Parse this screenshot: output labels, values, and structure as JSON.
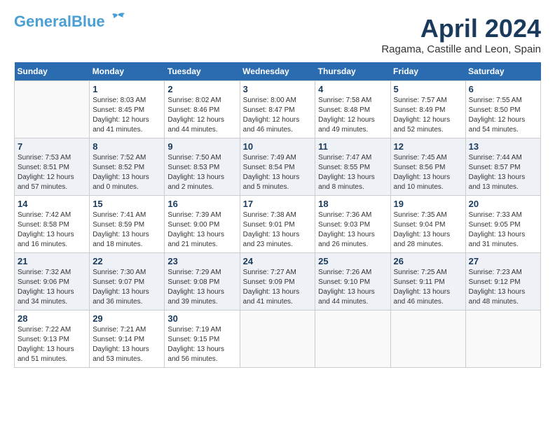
{
  "header": {
    "logo_line1": "General",
    "logo_line2": "Blue",
    "month_title": "April 2024",
    "location": "Ragama, Castille and Leon, Spain"
  },
  "days_of_week": [
    "Sunday",
    "Monday",
    "Tuesday",
    "Wednesday",
    "Thursday",
    "Friday",
    "Saturday"
  ],
  "weeks": [
    [
      {
        "day": "",
        "info": ""
      },
      {
        "day": "1",
        "info": "Sunrise: 8:03 AM\nSunset: 8:45 PM\nDaylight: 12 hours\nand 41 minutes."
      },
      {
        "day": "2",
        "info": "Sunrise: 8:02 AM\nSunset: 8:46 PM\nDaylight: 12 hours\nand 44 minutes."
      },
      {
        "day": "3",
        "info": "Sunrise: 8:00 AM\nSunset: 8:47 PM\nDaylight: 12 hours\nand 46 minutes."
      },
      {
        "day": "4",
        "info": "Sunrise: 7:58 AM\nSunset: 8:48 PM\nDaylight: 12 hours\nand 49 minutes."
      },
      {
        "day": "5",
        "info": "Sunrise: 7:57 AM\nSunset: 8:49 PM\nDaylight: 12 hours\nand 52 minutes."
      },
      {
        "day": "6",
        "info": "Sunrise: 7:55 AM\nSunset: 8:50 PM\nDaylight: 12 hours\nand 54 minutes."
      }
    ],
    [
      {
        "day": "7",
        "info": "Sunrise: 7:53 AM\nSunset: 8:51 PM\nDaylight: 12 hours\nand 57 minutes."
      },
      {
        "day": "8",
        "info": "Sunrise: 7:52 AM\nSunset: 8:52 PM\nDaylight: 13 hours\nand 0 minutes."
      },
      {
        "day": "9",
        "info": "Sunrise: 7:50 AM\nSunset: 8:53 PM\nDaylight: 13 hours\nand 2 minutes."
      },
      {
        "day": "10",
        "info": "Sunrise: 7:49 AM\nSunset: 8:54 PM\nDaylight: 13 hours\nand 5 minutes."
      },
      {
        "day": "11",
        "info": "Sunrise: 7:47 AM\nSunset: 8:55 PM\nDaylight: 13 hours\nand 8 minutes."
      },
      {
        "day": "12",
        "info": "Sunrise: 7:45 AM\nSunset: 8:56 PM\nDaylight: 13 hours\nand 10 minutes."
      },
      {
        "day": "13",
        "info": "Sunrise: 7:44 AM\nSunset: 8:57 PM\nDaylight: 13 hours\nand 13 minutes."
      }
    ],
    [
      {
        "day": "14",
        "info": "Sunrise: 7:42 AM\nSunset: 8:58 PM\nDaylight: 13 hours\nand 16 minutes."
      },
      {
        "day": "15",
        "info": "Sunrise: 7:41 AM\nSunset: 8:59 PM\nDaylight: 13 hours\nand 18 minutes."
      },
      {
        "day": "16",
        "info": "Sunrise: 7:39 AM\nSunset: 9:00 PM\nDaylight: 13 hours\nand 21 minutes."
      },
      {
        "day": "17",
        "info": "Sunrise: 7:38 AM\nSunset: 9:01 PM\nDaylight: 13 hours\nand 23 minutes."
      },
      {
        "day": "18",
        "info": "Sunrise: 7:36 AM\nSunset: 9:03 PM\nDaylight: 13 hours\nand 26 minutes."
      },
      {
        "day": "19",
        "info": "Sunrise: 7:35 AM\nSunset: 9:04 PM\nDaylight: 13 hours\nand 28 minutes."
      },
      {
        "day": "20",
        "info": "Sunrise: 7:33 AM\nSunset: 9:05 PM\nDaylight: 13 hours\nand 31 minutes."
      }
    ],
    [
      {
        "day": "21",
        "info": "Sunrise: 7:32 AM\nSunset: 9:06 PM\nDaylight: 13 hours\nand 34 minutes."
      },
      {
        "day": "22",
        "info": "Sunrise: 7:30 AM\nSunset: 9:07 PM\nDaylight: 13 hours\nand 36 minutes."
      },
      {
        "day": "23",
        "info": "Sunrise: 7:29 AM\nSunset: 9:08 PM\nDaylight: 13 hours\nand 39 minutes."
      },
      {
        "day": "24",
        "info": "Sunrise: 7:27 AM\nSunset: 9:09 PM\nDaylight: 13 hours\nand 41 minutes."
      },
      {
        "day": "25",
        "info": "Sunrise: 7:26 AM\nSunset: 9:10 PM\nDaylight: 13 hours\nand 44 minutes."
      },
      {
        "day": "26",
        "info": "Sunrise: 7:25 AM\nSunset: 9:11 PM\nDaylight: 13 hours\nand 46 minutes."
      },
      {
        "day": "27",
        "info": "Sunrise: 7:23 AM\nSunset: 9:12 PM\nDaylight: 13 hours\nand 48 minutes."
      }
    ],
    [
      {
        "day": "28",
        "info": "Sunrise: 7:22 AM\nSunset: 9:13 PM\nDaylight: 13 hours\nand 51 minutes."
      },
      {
        "day": "29",
        "info": "Sunrise: 7:21 AM\nSunset: 9:14 PM\nDaylight: 13 hours\nand 53 minutes."
      },
      {
        "day": "30",
        "info": "Sunrise: 7:19 AM\nSunset: 9:15 PM\nDaylight: 13 hours\nand 56 minutes."
      },
      {
        "day": "",
        "info": ""
      },
      {
        "day": "",
        "info": ""
      },
      {
        "day": "",
        "info": ""
      },
      {
        "day": "",
        "info": ""
      }
    ]
  ]
}
